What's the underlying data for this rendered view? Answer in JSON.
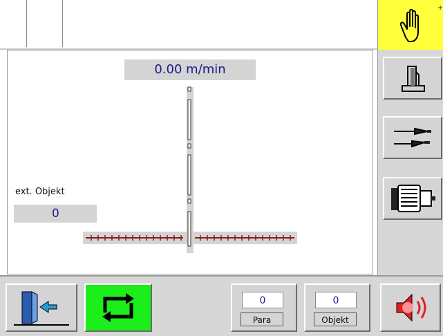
{
  "display": {
    "speed_value": "0.00 m/min"
  },
  "ext_object": {
    "label": "ext. Objekt",
    "value": "0"
  },
  "right_panel": {
    "mode_icon": "hand-icon",
    "buttons": [
      {
        "icon": "machine-head-icon"
      },
      {
        "icon": "tools-icon"
      },
      {
        "icon": "motor-icon"
      }
    ],
    "accent": "#ffff3c"
  },
  "bottom": {
    "exit_icon": "exit-door-icon",
    "cycle_icon": "cycle-arrows-icon",
    "cycle_color": "#1bee1b",
    "para": {
      "value": "0",
      "label": "Para"
    },
    "objekt": {
      "value": "0",
      "label": "Objekt"
    },
    "sound_icon": "sound-icon"
  }
}
